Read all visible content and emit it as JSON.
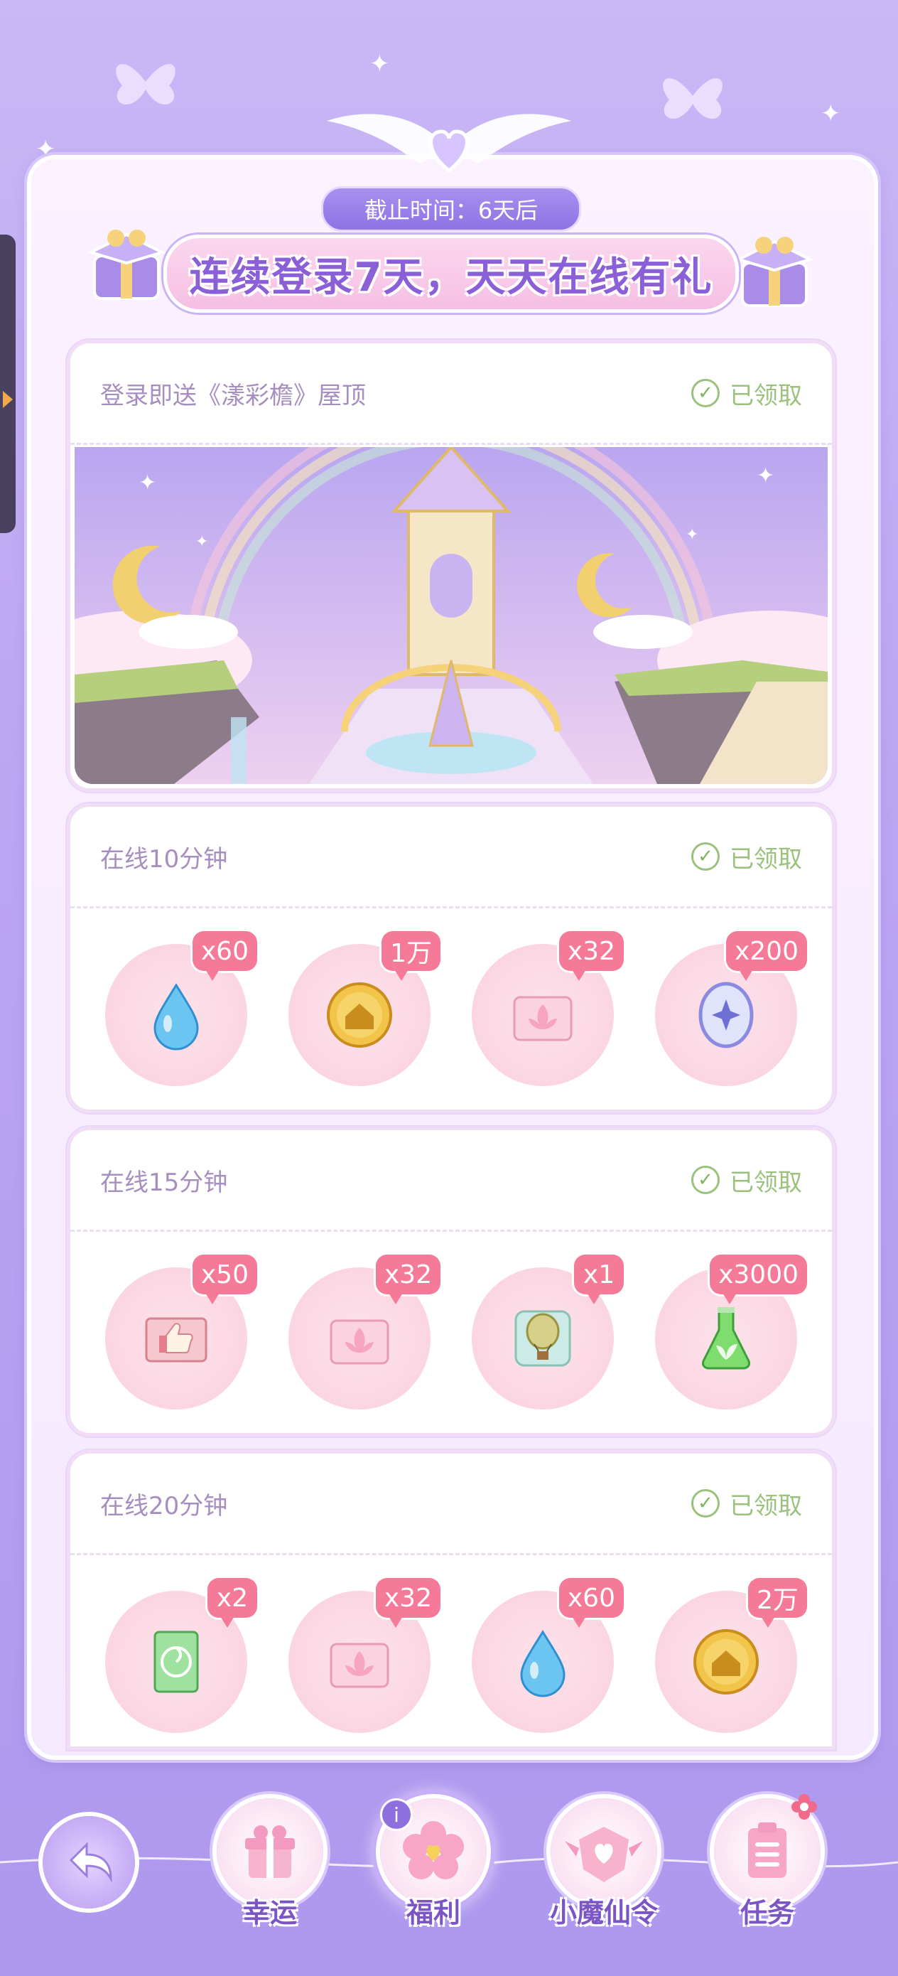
{
  "header": {
    "deadline": "截止时间：6天后",
    "title": "连续登录7天，天天在线有礼"
  },
  "cards": [
    {
      "title": "登录即送《漾彩檐》屋顶",
      "status": "已领取"
    },
    {
      "title": "在线10分钟",
      "status": "已领取",
      "rewards": [
        {
          "icon": "water-drop-icon",
          "qty": "x60"
        },
        {
          "icon": "gold-coin-icon",
          "qty": "1万"
        },
        {
          "icon": "lotus-card-icon",
          "qty": "x32"
        },
        {
          "icon": "magic-orb-icon",
          "qty": "x200"
        }
      ]
    },
    {
      "title": "在线15分钟",
      "status": "已领取",
      "rewards": [
        {
          "icon": "thumbs-up-card-icon",
          "qty": "x50"
        },
        {
          "icon": "lotus-card-icon",
          "qty": "x32"
        },
        {
          "icon": "hot-air-balloon-icon",
          "qty": "x1"
        },
        {
          "icon": "potion-flask-icon",
          "qty": "x3000"
        }
      ]
    },
    {
      "title": "在线20分钟",
      "status": "已领取",
      "rewards": [
        {
          "icon": "leaf-card-icon",
          "qty": "x2"
        },
        {
          "icon": "lotus-card-icon",
          "qty": "x32"
        },
        {
          "icon": "water-drop-icon",
          "qty": "x60"
        },
        {
          "icon": "gold-coin-icon",
          "qty": "2万"
        }
      ]
    }
  ],
  "nav": [
    {
      "label": "幸运",
      "icon": "gift-icon"
    },
    {
      "label": "福利",
      "icon": "flower-icon"
    },
    {
      "label": "小魔仙令",
      "icon": "emblem-icon"
    },
    {
      "label": "任务",
      "icon": "clipboard-icon"
    }
  ],
  "colors": {
    "accent": "#8a5fd8",
    "badge": "#f47a98",
    "claimed": "#9ac27c"
  }
}
